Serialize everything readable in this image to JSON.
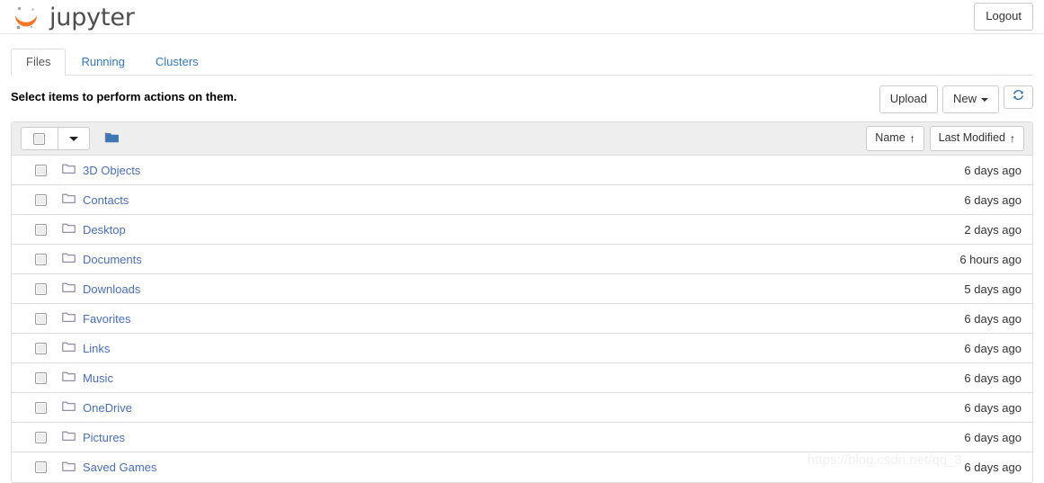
{
  "header": {
    "brand_text": "jupyter",
    "logo_icon": "jupyter-logo-icon",
    "logout_label": "Logout"
  },
  "tabs": [
    {
      "label": "Files",
      "active": true
    },
    {
      "label": "Running",
      "active": false
    },
    {
      "label": "Clusters",
      "active": false
    }
  ],
  "toolbar": {
    "select_hint": "Select items to perform actions on them.",
    "upload_label": "Upload",
    "new_label": "New",
    "refresh_icon": "refresh-icon"
  },
  "list_header": {
    "select_all_checked": false,
    "dropdown_icon": "chevron-down-icon",
    "breadcrumb_folder_icon": "folder-filled-icon",
    "sort_name_label": "Name",
    "sort_modified_label": "Last Modified",
    "sort_name_arrow": "↑",
    "sort_modified_arrow": "↑"
  },
  "files": [
    {
      "name": "3D Objects",
      "modified": "6 days ago",
      "icon": "folder-icon",
      "checked": false
    },
    {
      "name": "Contacts",
      "modified": "6 days ago",
      "icon": "folder-icon",
      "checked": false
    },
    {
      "name": "Desktop",
      "modified": "2 days ago",
      "icon": "folder-icon",
      "checked": false
    },
    {
      "name": "Documents",
      "modified": "6 hours ago",
      "icon": "folder-icon",
      "checked": false
    },
    {
      "name": "Downloads",
      "modified": "5 days ago",
      "icon": "folder-icon",
      "checked": false
    },
    {
      "name": "Favorites",
      "modified": "6 days ago",
      "icon": "folder-icon",
      "checked": false
    },
    {
      "name": "Links",
      "modified": "6 days ago",
      "icon": "folder-icon",
      "checked": false
    },
    {
      "name": "Music",
      "modified": "6 days ago",
      "icon": "folder-icon",
      "checked": false
    },
    {
      "name": "OneDrive",
      "modified": "6 days ago",
      "icon": "folder-icon",
      "checked": false
    },
    {
      "name": "Pictures",
      "modified": "6 days ago",
      "icon": "folder-icon",
      "checked": false
    },
    {
      "name": "Saved Games",
      "modified": "6 days ago",
      "icon": "folder-icon",
      "checked": false
    }
  ],
  "watermark": {
    "text": "https://blog.csdn.net/qq_3"
  },
  "colors": {
    "link_blue": "#4a6fb5",
    "tab_blue": "#337ab7",
    "folder_outline": "#8a7f9e",
    "folder_filled": "#3c78b4",
    "border": "#dddddd",
    "header_bg": "#eeeeee",
    "logo_orange": "#f37726"
  }
}
